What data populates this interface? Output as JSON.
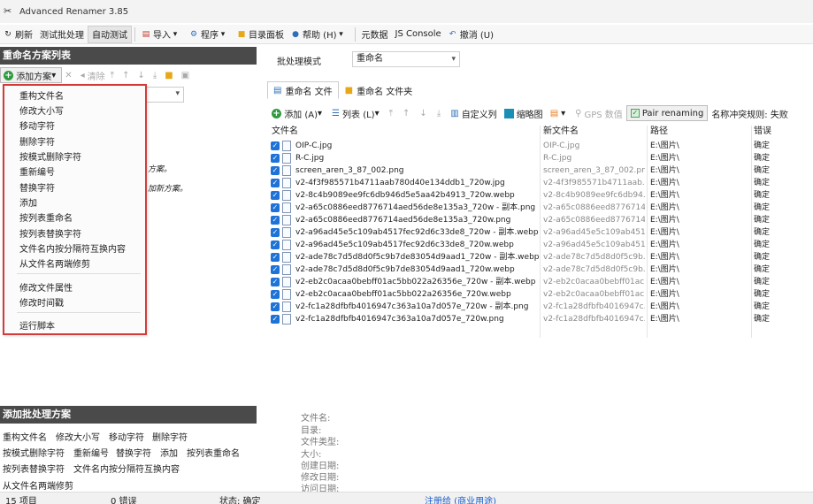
{
  "window": {
    "title": "Advanced Renamer 3.85"
  },
  "toolbar": {
    "refresh": "刷新",
    "test_batch": "测试批处理",
    "auto_test": "自动测试",
    "import": "导入",
    "programs": "程序",
    "dir_panel": "目录面板",
    "help": "帮助 (H)",
    "metadata": "元数据",
    "js_console": "JS Console",
    "undo": "撤消 (U)"
  },
  "left": {
    "header": "重命名方案列表",
    "add_method": "添加方案",
    "remove": "清除",
    "bg_text_1": "方案。",
    "bg_text_2": "加新方案。"
  },
  "menu": {
    "items": [
      "重构文件名",
      "修改大小写",
      "移动字符",
      "删除字符",
      "按模式删除字符",
      "重新编号",
      "替换字符",
      "添加",
      "按列表重命名",
      "按列表替换字符",
      "文件名内按分隔符互换内容",
      "从文件名两端修剪",
      "修改文件属性",
      "修改时间戳",
      "运行脚本"
    ]
  },
  "right": {
    "mode_label": "批处理模式",
    "mode_value": "重命名",
    "tab_files": "重命名 文件",
    "tab_folders": "重命名 文件夹",
    "list_tb": {
      "add": "添加 (A)",
      "list": "列表 (L)",
      "custom_columns": "自定义列",
      "thumbnails": "缩略图",
      "gps": "GPS 数值",
      "pair": "Pair renaming",
      "conflict": "名称冲突规则: 失败"
    },
    "columns": {
      "name": "文件名",
      "new_name": "新文件名",
      "path": "路径",
      "error": "错误"
    },
    "rows": [
      {
        "name": "OIP-C.jpg",
        "new": "OIP-C.jpg",
        "path": "E:\\图片\\",
        "err": "确定"
      },
      {
        "name": "R-C.jpg",
        "new": "R-C.jpg",
        "path": "E:\\图片\\",
        "err": "确定"
      },
      {
        "name": "screen_aren_3_87_002.png",
        "new": "screen_aren_3_87_002.png",
        "path": "E:\\图片\\",
        "err": "确定"
      },
      {
        "name": "v2-4f3f985571b4711aab780d40e134ddb1_720w.jpg",
        "new": "v2-4f3f985571b4711aab...",
        "path": "E:\\图片\\",
        "err": "确定"
      },
      {
        "name": "v2-8c4b9089ee9fc6db946d5e5aa42b4913_720w.webp",
        "new": "v2-8c4b9089ee9fc6db94...",
        "path": "E:\\图片\\",
        "err": "确定"
      },
      {
        "name": "v2-a65c0886eed8776714aed56de8e135a3_720w - 副本.png",
        "new": "v2-a65c0886eed8776714...",
        "path": "E:\\图片\\",
        "err": "确定"
      },
      {
        "name": "v2-a65c0886eed8776714aed56de8e135a3_720w.png",
        "new": "v2-a65c0886eed8776714...",
        "path": "E:\\图片\\",
        "err": "确定"
      },
      {
        "name": "v2-a96ad45e5c109ab4517fec92d6c33de8_720w - 副本.webp",
        "new": "v2-a96ad45e5c109ab451...",
        "path": "E:\\图片\\",
        "err": "确定"
      },
      {
        "name": "v2-a96ad45e5c109ab4517fec92d6c33de8_720w.webp",
        "new": "v2-a96ad45e5c109ab451...",
        "path": "E:\\图片\\",
        "err": "确定"
      },
      {
        "name": "v2-ade78c7d5d8d0f5c9b7de83054d9aad1_720w - 副本.webp",
        "new": "v2-ade78c7d5d8d0f5c9b...",
        "path": "E:\\图片\\",
        "err": "确定"
      },
      {
        "name": "v2-ade78c7d5d8d0f5c9b7de83054d9aad1_720w.webp",
        "new": "v2-ade78c7d5d8d0f5c9b...",
        "path": "E:\\图片\\",
        "err": "确定"
      },
      {
        "name": "v2-eb2c0acaa0bebff01ac5bb022a26356e_720w - 副本.webp",
        "new": "v2-eb2c0acaa0bebff01ac...",
        "path": "E:\\图片\\",
        "err": "确定"
      },
      {
        "name": "v2-eb2c0acaa0bebff01ac5bb022a26356e_720w.webp",
        "new": "v2-eb2c0acaa0bebff01ac...",
        "path": "E:\\图片\\",
        "err": "确定"
      },
      {
        "name": "v2-fc1a28dfbfb4016947c363a10a7d057e_720w - 副本.png",
        "new": "v2-fc1a28dfbfb4016947c...",
        "path": "E:\\图片\\",
        "err": "确定"
      },
      {
        "name": "v2-fc1a28dfbfb4016947c363a10a7d057e_720w.png",
        "new": "v2-fc1a28dfbfb4016947c...",
        "path": "E:\\图片\\",
        "err": "确定"
      }
    ]
  },
  "batch": {
    "header": "添加批处理方案",
    "items": [
      "重构文件名",
      "修改大小写",
      "移动字符",
      "删除字符",
      "按模式删除字符",
      "重新编号",
      "替换字符",
      "添加",
      "按列表重命名",
      "按列表替换字符",
      "文件名内按分隔符互换内容",
      "从文件名两端修剪"
    ]
  },
  "info": {
    "labels": [
      "文件名:",
      "目录:",
      "文件类型:",
      "大小:",
      "创建日期:",
      "修改日期:",
      "访问日期:"
    ]
  },
  "status": {
    "items": "15 项目",
    "errors": "0 错误",
    "state": "状态: 确定",
    "registered": "注册给 (商业用途)"
  }
}
